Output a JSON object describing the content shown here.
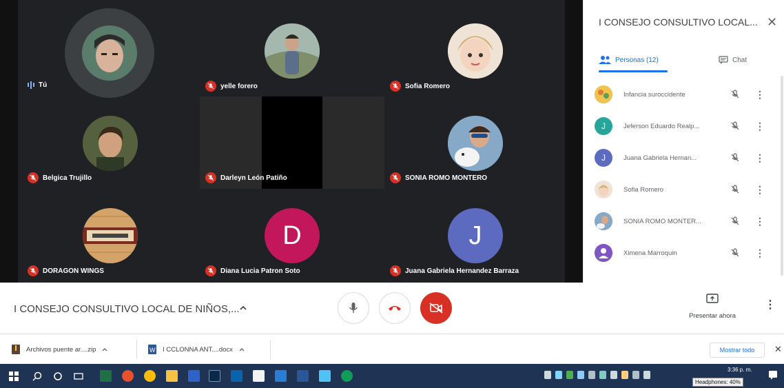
{
  "meeting": {
    "title": "I CONSEJO CONSULTIVO LOCAL DE NIÑOS,...",
    "present_label": "Presentar ahora"
  },
  "tiles": [
    {
      "name": "Tú",
      "state": "speaking"
    },
    {
      "name": "yelle forero",
      "state": "muted"
    },
    {
      "name": "Sofia Romero",
      "state": "muted"
    },
    {
      "name": "Belgica Trujillo",
      "state": "muted"
    },
    {
      "name": "Darleyn León Patiño",
      "state": "muted"
    },
    {
      "name": "SONIA ROMO MONTERO",
      "state": "muted"
    },
    {
      "name": "DORAGON WINGS",
      "state": "muted"
    },
    {
      "name": "Diana Lucia Patron Soto",
      "state": "muted",
      "initial": "D"
    },
    {
      "name": "Juana Gabriela Hernandez Barraza",
      "state": "muted",
      "initial": "J"
    }
  ],
  "panel": {
    "title": "I CONSEJO CONSULTIVO LOCAL...",
    "tab_people": "Personas (12)",
    "tab_chat": "Chat",
    "people": [
      {
        "name": "Infancia suroccidente",
        "initial": ""
      },
      {
        "name": "Jeferson Eduardo Realp...",
        "initial": "J"
      },
      {
        "name": "Juana Gabriela Hernan...",
        "initial": "J"
      },
      {
        "name": "Sofia Romero",
        "initial": ""
      },
      {
        "name": "SONIA ROMO MONTER...",
        "initial": ""
      },
      {
        "name": "Ximena Marroquin",
        "initial": ""
      }
    ]
  },
  "downloads": {
    "items": [
      {
        "name": "Archivos puente ar....zip"
      },
      {
        "name": "I CCLONNA ANT....docx"
      }
    ],
    "show_all": "Mostrar todo"
  },
  "taskbar": {
    "clock": "3:36 p. m.",
    "tooltip": "Headphones: 40%"
  },
  "colors": {
    "grid_bg": "#202124",
    "mute_red": "#d93025",
    "accent_blue": "#1a73e8",
    "avatar_d": "#c2185b",
    "avatar_j": "#5c6bc0",
    "taskbar": "#1f3354"
  },
  "icons": {
    "mic_off": "mic-off-icon",
    "people": "people-icon",
    "chat": "chat-icon",
    "close": "close-icon",
    "more": "more-vert-icon",
    "hangup": "hangup-icon",
    "camera_off": "camera-off-icon",
    "present": "present-icon"
  }
}
